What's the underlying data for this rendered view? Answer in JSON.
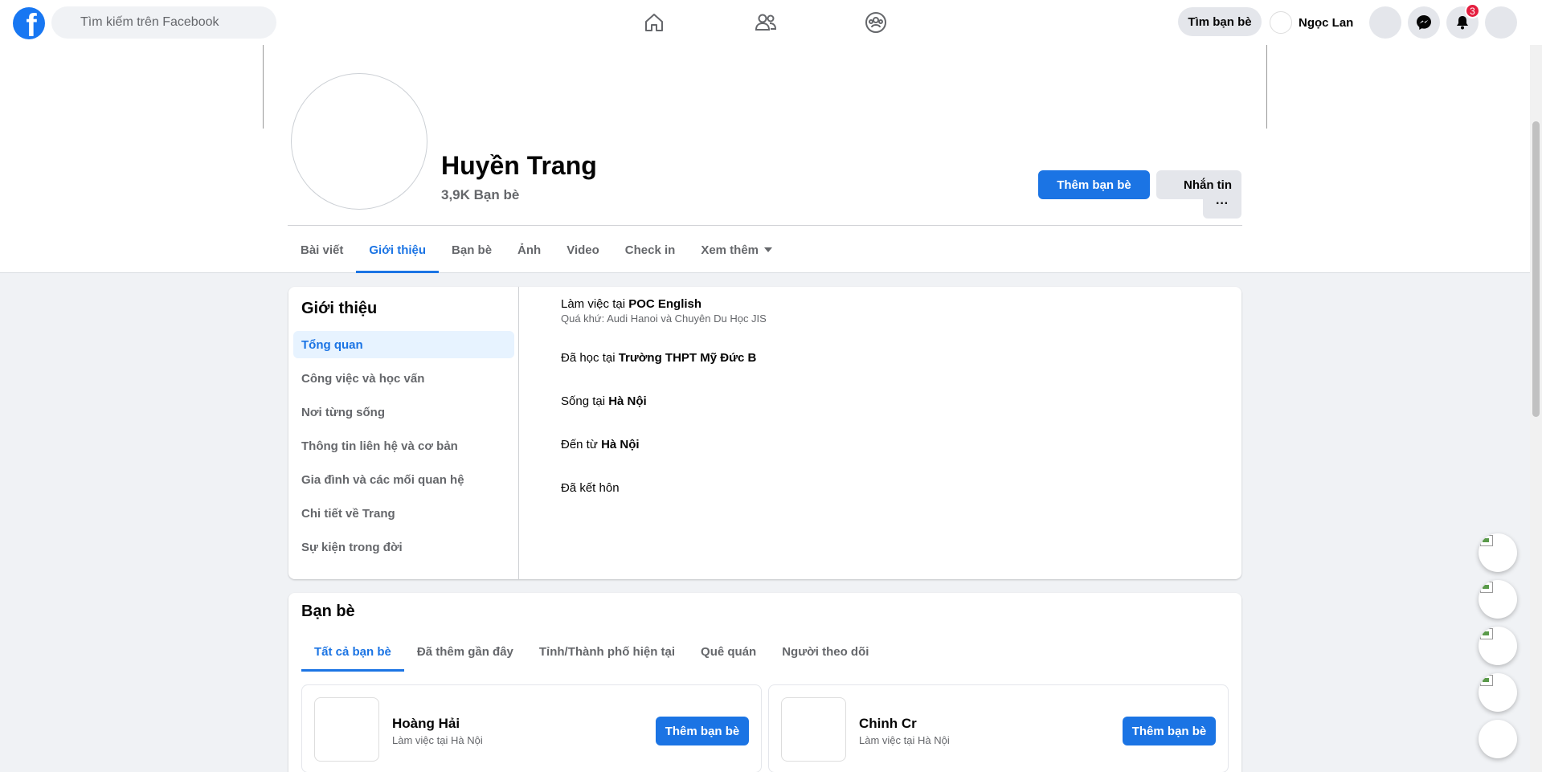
{
  "topbar": {
    "search_placeholder": "Tìm kiếm trên Facebook",
    "find_friends_label": "Tìm bạn bè",
    "user_name": "Ngọc Lan",
    "notification_count": "3"
  },
  "profile": {
    "name": "Huyền Trang",
    "friend_count": "3,9K Bạn bè",
    "add_friend_label": "Thêm bạn bè",
    "message_label": "Nhắn tin",
    "more_label": "···",
    "tabs": [
      {
        "label": "Bài viết"
      },
      {
        "label": "Giới thiệu"
      },
      {
        "label": "Bạn bè"
      },
      {
        "label": "Ảnh"
      },
      {
        "label": "Video"
      },
      {
        "label": "Check in"
      },
      {
        "label": "Xem thêm"
      }
    ]
  },
  "about": {
    "title": "Giới thiệu",
    "menu": [
      {
        "label": "Tổng quan"
      },
      {
        "label": "Công việc và học vấn"
      },
      {
        "label": "Nơi từng sống"
      },
      {
        "label": "Thông tin liên hệ và cơ bản"
      },
      {
        "label": "Gia đình và các mối quan hệ"
      },
      {
        "label": "Chi tiết về Trang"
      },
      {
        "label": "Sự kiện trong đời"
      }
    ],
    "work_prefix": "Làm việc tại ",
    "work_place": "POC English",
    "work_past": "Quá khứ: Audi Hanoi và Chuyên Du Học JIS",
    "study_prefix": "Đã học tại ",
    "study_place": "Trường THPT Mỹ Đức B",
    "live_prefix": "Sống tại ",
    "live_place": "Hà Nội",
    "from_prefix": "Đến từ ",
    "from_place": "Hà Nội",
    "relationship": "Đã kết hôn"
  },
  "friends": {
    "title": "Bạn bè",
    "tabs": [
      {
        "label": "Tất cả bạn bè"
      },
      {
        "label": "Đã thêm gần đây"
      },
      {
        "label": "Tỉnh/Thành phố hiện tại"
      },
      {
        "label": "Quê quán"
      },
      {
        "label": "Người theo dõi"
      }
    ],
    "list": [
      {
        "name": "Hoàng Hải",
        "sub": "Làm việc tại Hà Nội",
        "button": "Thêm bạn bè"
      },
      {
        "name": "Chinh Cr",
        "sub": "Làm việc tại Hà Nội",
        "button": "Thêm bạn bè"
      }
    ]
  },
  "icons": {
    "logo": "facebook-logo",
    "home": "home-icon",
    "friends": "friends-icon",
    "groups": "groups-icon",
    "messenger": "messenger-icon",
    "notifications": "bell-icon"
  },
  "colors": {
    "brand": "#1877f2",
    "accent": "#1b74e4",
    "badge": "#e41e3f",
    "page_bg": "#f0f2f5"
  }
}
